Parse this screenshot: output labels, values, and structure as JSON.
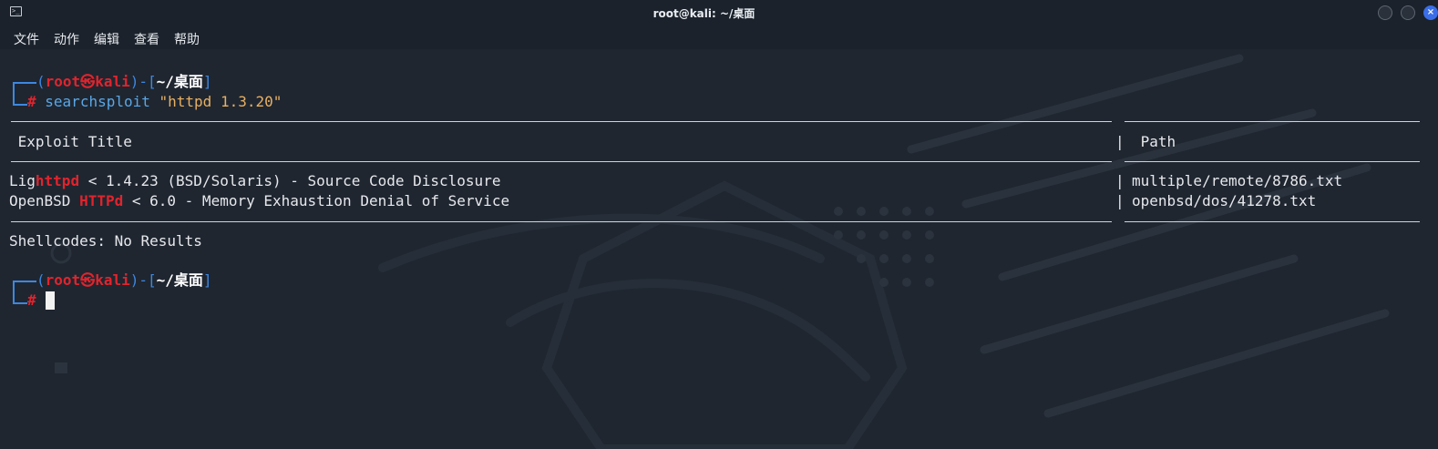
{
  "window": {
    "title": "root@kali: ~/桌面",
    "close_glyph": "×"
  },
  "menu": {
    "items": [
      "文件",
      "动作",
      "编辑",
      "查看",
      "帮助"
    ]
  },
  "prompt": {
    "open_paren": "(",
    "user": "root",
    "at": "㉿",
    "host": "kali",
    "close_paren": ")",
    "dash": "-",
    "open_bracket": "[",
    "path": "~/桌面",
    "close_bracket": "]",
    "hash": "#"
  },
  "command": {
    "program": "searchsploit",
    "arg": "\"httpd 1.3.20\""
  },
  "table": {
    "header_title": " Exploit Title",
    "header_sep": "|",
    "header_path": " Path",
    "rows": [
      {
        "title_pre": "Lig",
        "title_hl": "httpd",
        "title_post": " < 1.4.23 (BSD/Solaris) - Source Code Disclosure",
        "sep": "|",
        "path": "multiple/remote/8786.txt"
      },
      {
        "title_pre": "OpenBSD ",
        "title_hl": "HTTPd",
        "title_post": " < 6.0 - Memory Exhaustion Denial of Service",
        "sep": "|",
        "path": "openbsd/dos/41278.txt"
      }
    ]
  },
  "shellcodes": "Shellcodes: No Results"
}
